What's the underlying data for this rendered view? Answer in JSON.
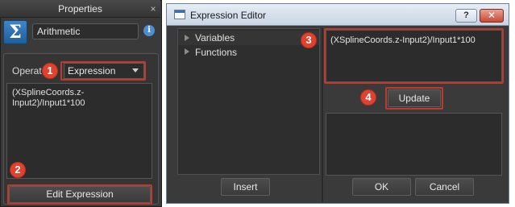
{
  "properties_panel": {
    "title": "Properties",
    "close_glyph": "×",
    "operator_icon_glyph": "Σ",
    "name_value": "Arithmetic",
    "info_glyph": "i",
    "operation_label": "Operat",
    "operation_value": "Expression",
    "expression_text": "(XSplineCoords.z-Input2)/Input1*100",
    "edit_button_label": "Edit Expression"
  },
  "expression_editor": {
    "title": "Expression Editor",
    "help_glyph": "?",
    "close_glyph": "✕",
    "tree": [
      {
        "label": "Variables"
      },
      {
        "label": "Functions"
      }
    ],
    "expression_text": "(XSplineCoords.z-Input2)/Input1*100",
    "update_label": "Update",
    "insert_label": "Insert",
    "ok_label": "OK",
    "cancel_label": "Cancel"
  },
  "callouts": [
    "1",
    "2",
    "3",
    "4"
  ],
  "colors": {
    "panel_bg": "#3a3a3a",
    "field_bg": "#2c2c2c",
    "callout_red": "#e0422e",
    "titlebar": "#c8d5e3"
  }
}
